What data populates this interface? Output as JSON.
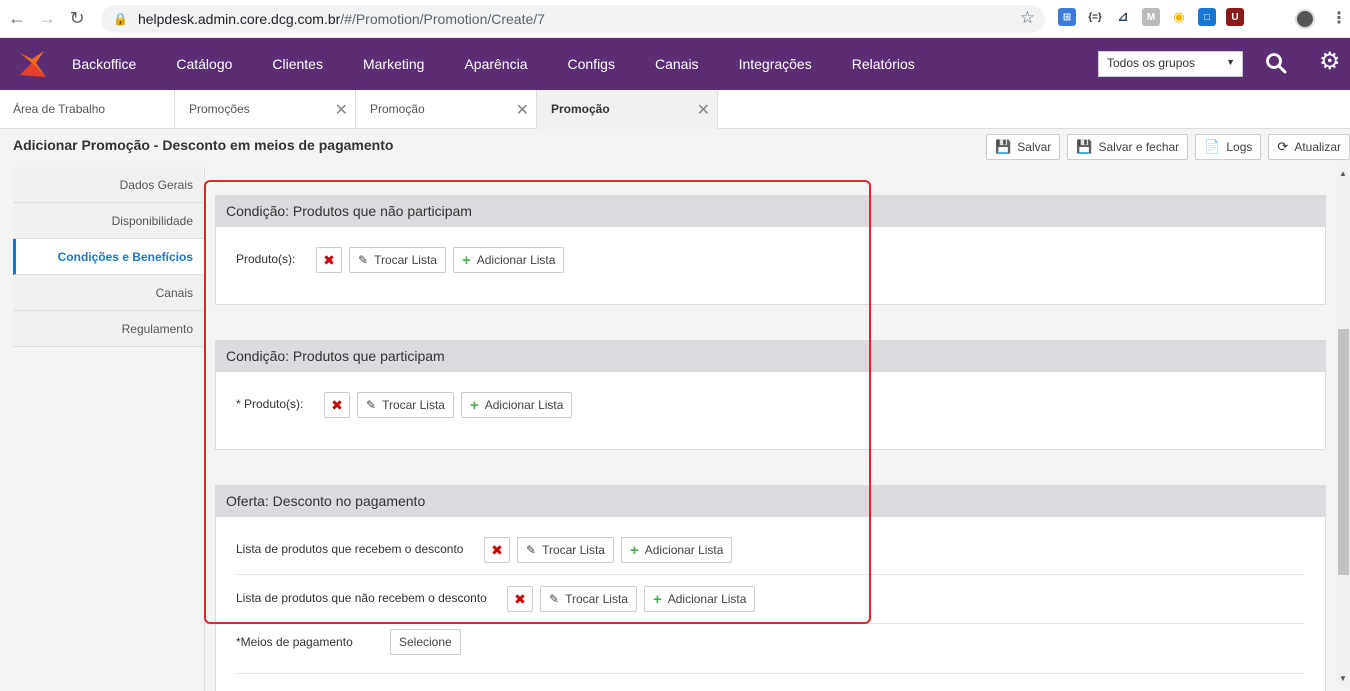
{
  "browser": {
    "url_host": "helpdesk.admin.core.dcg.com.br",
    "url_path": "/#/Promotion/Promotion/Create/7"
  },
  "nav": {
    "items": [
      "Backoffice",
      "Catálogo",
      "Clientes",
      "Marketing",
      "Aparência",
      "Configs",
      "Canais",
      "Integrações",
      "Relatórios"
    ],
    "group_select": "Todos os grupos"
  },
  "tabs": [
    {
      "label": "Área de Trabalho"
    },
    {
      "label": "Promoções"
    },
    {
      "label": "Promoção"
    },
    {
      "label": "Promoção"
    }
  ],
  "page": {
    "title": "Adicionar Promoção - Desconto em meios de pagamento",
    "toolbar": {
      "save": "Salvar",
      "save_close": "Salvar e fechar",
      "logs": "Logs",
      "refresh": "Atualizar"
    }
  },
  "sidebar": {
    "items": [
      "Dados Gerais",
      "Disponibilidade",
      "Condições e Benefícios",
      "Canais",
      "Regulamento"
    ]
  },
  "sections": [
    {
      "title": "Condição: Produtos que não participam",
      "rows": [
        {
          "label": "Produto(s):"
        }
      ]
    },
    {
      "title": "Condição: Produtos que participam",
      "rows": [
        {
          "label": "* Produto(s):"
        }
      ]
    },
    {
      "title": "Oferta: Desconto no pagamento",
      "rows": [
        {
          "label": "Lista de produtos que recebem o desconto"
        },
        {
          "label": "Lista de produtos que não recebem o desconto"
        }
      ]
    }
  ],
  "buttons": {
    "swap": "Trocar Lista",
    "add": "Adicionar Lista"
  },
  "payment": {
    "label": "*Meios de pagamento",
    "select": "Selecione"
  },
  "colors": {
    "nav_bg": "#5b2e74",
    "active_link": "#1a78c9",
    "highlight": "#e0262a"
  }
}
